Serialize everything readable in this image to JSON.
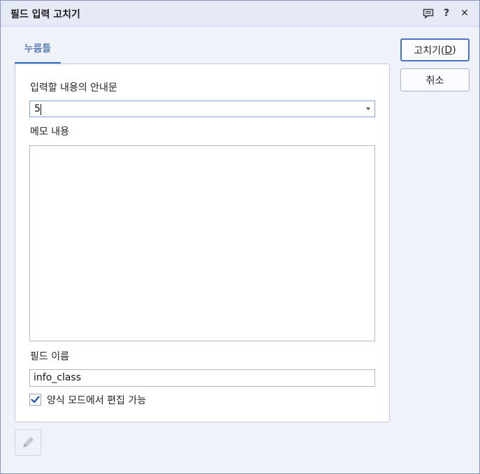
{
  "dialog": {
    "title": "필드 입력 고치기"
  },
  "titlebar_icons": [
    "comment-icon",
    "help-icon",
    "close-icon"
  ],
  "titlebar": {
    "help_glyph": "?",
    "close_glyph": "✕"
  },
  "tabs": [
    {
      "label": "누름틀",
      "selected": true
    }
  ],
  "form": {
    "guide_label": "입력할 내용의 안내문",
    "guide_value": "5",
    "memo_label": "메모 내용",
    "memo_value": "",
    "field_name_label": "필드 이름",
    "field_name_value": "info_class",
    "editable_label": "양식 모드에서 편집 가능",
    "editable_checked": true
  },
  "buttons": {
    "ok_label_prefix": "고치기(",
    "ok_label_key": "D",
    "ok_label_suffix": ")",
    "cancel_label": "취소"
  },
  "colors": {
    "accent": "#2f69c9",
    "tab_text": "#1a4e9b",
    "primary_border": "#4a72c2"
  }
}
